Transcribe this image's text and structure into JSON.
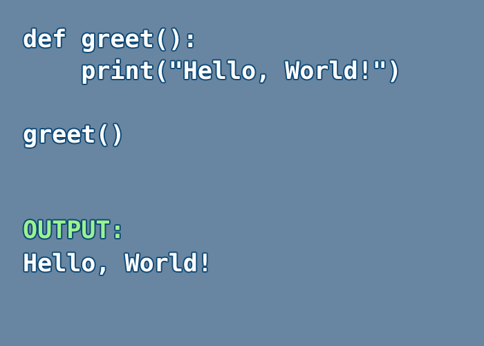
{
  "code": {
    "lines": [
      "def greet():",
      "    print(\"Hello, World!\")",
      "greet()"
    ]
  },
  "output": {
    "label": "OUTPUT:",
    "value": "Hello, World!"
  },
  "colors": {
    "background": "#6886a1",
    "code_text": "#ffffff",
    "output_label": "#9cf28f",
    "outline": "#0f4a78"
  }
}
